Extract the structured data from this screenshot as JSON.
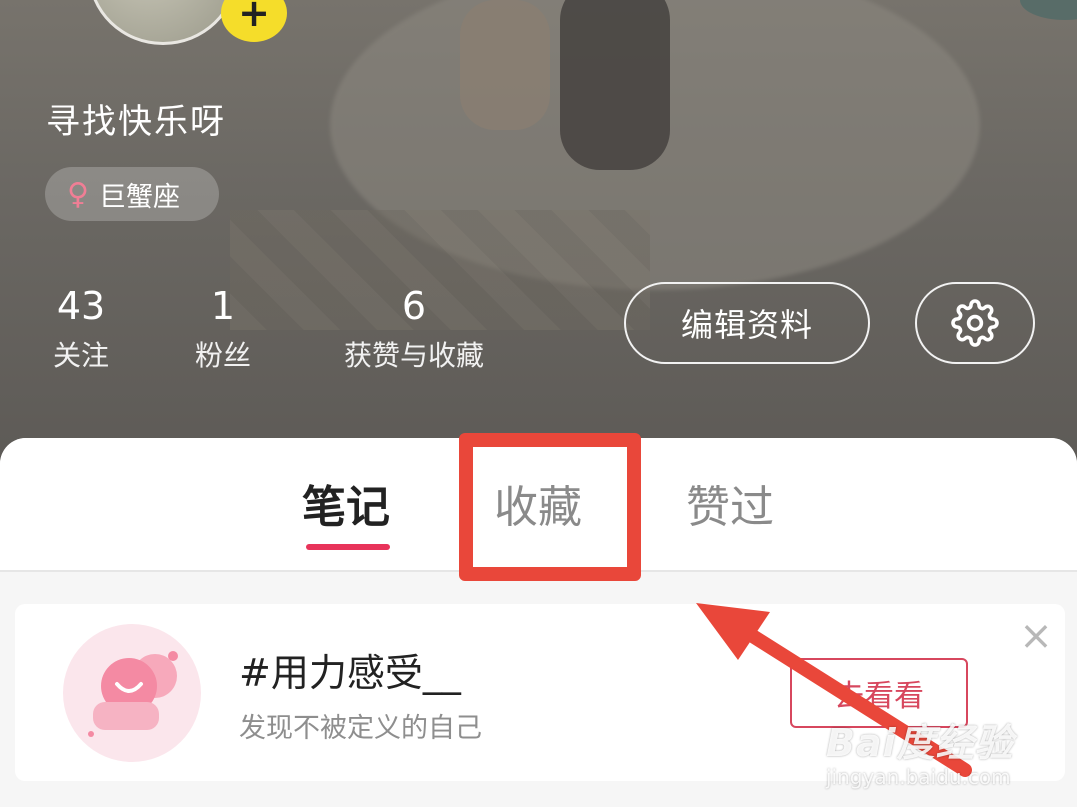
{
  "profile": {
    "username": "寻找快乐呀",
    "zodiac": "巨蟹座",
    "gender_icon": "female-icon",
    "avatar_add_icon": "+"
  },
  "stats": [
    {
      "value": "43",
      "label": "关注"
    },
    {
      "value": "1",
      "label": "粉丝"
    },
    {
      "value": "6",
      "label": "获赞与收藏"
    }
  ],
  "buttons": {
    "edit_profile": "编辑资料",
    "settings_icon": "gear-icon"
  },
  "tabs": [
    {
      "label": "笔记",
      "active": true
    },
    {
      "label": "收藏",
      "active": false
    },
    {
      "label": "赞过",
      "active": false
    }
  ],
  "promo": {
    "title": "#用力感受__",
    "subtitle": "发现不被定义的自己",
    "button": "去看看",
    "close": "×"
  },
  "watermark": {
    "main": "Bai度经验",
    "sub": "jingyan.baidu.com"
  },
  "colors": {
    "accent": "#e8335a",
    "annotation": "#e9473a",
    "plus_badge": "#f5dd2a"
  }
}
